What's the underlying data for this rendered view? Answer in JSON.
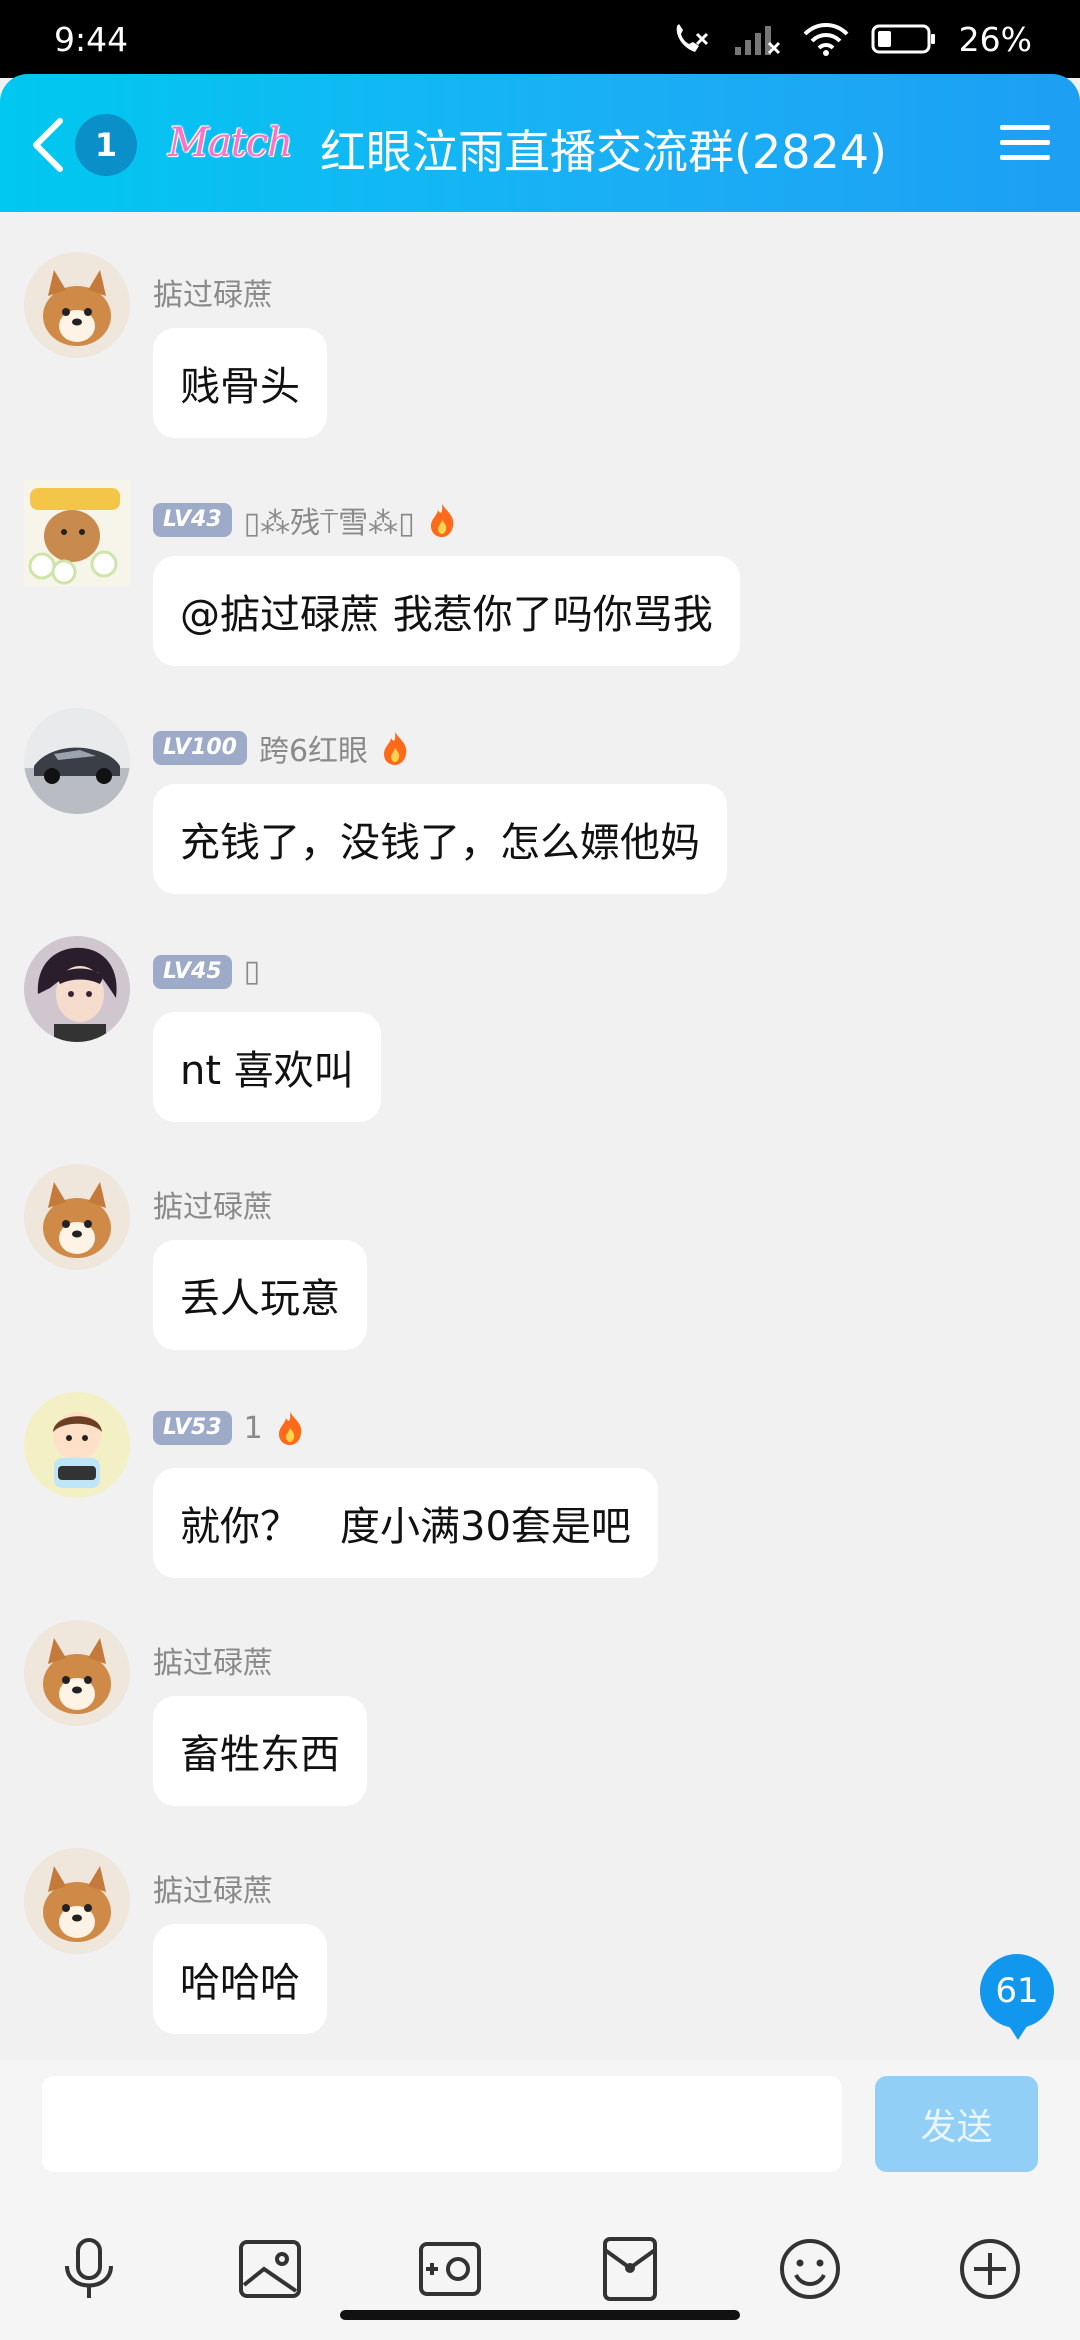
{
  "status_bar": {
    "time": "9:44",
    "battery": "26%"
  },
  "header": {
    "unread_count": "1",
    "logo_text": "Match",
    "title": "红眼泣雨直播交流群(2824)"
  },
  "messages": [
    {
      "sender": "掂过碌蔗",
      "level": "",
      "fire": false,
      "text": "贱骨头",
      "avatar": "shiba-dog-avatar"
    },
    {
      "sender": "▯⁂残⍑雪⁂▯",
      "level": "LV43",
      "fire": true,
      "text": "@掂过碌蔗 我惹你了吗你骂我",
      "avatar": "cartoon-flower-avatar"
    },
    {
      "sender": "跨6红眼",
      "level": "LV100",
      "fire": true,
      "text": "充钱了，没钱了，怎么嫖他妈",
      "avatar": "car-avatar"
    },
    {
      "sender": "▯",
      "level": "LV45",
      "fire": false,
      "text": "nt 喜欢叫",
      "avatar": "anime-boy-avatar"
    },
    {
      "sender": "掂过碌蔗",
      "level": "",
      "fire": false,
      "text": "丢人玩意",
      "avatar": "shiba-dog-avatar"
    },
    {
      "sender": "1",
      "level": "LV53",
      "fire": true,
      "text": "就你？　度小满30套是吧",
      "avatar": "cartoon-kid-avatar"
    },
    {
      "sender": "掂过碌蔗",
      "level": "",
      "fire": false,
      "text": "畜牲东西",
      "avatar": "shiba-dog-avatar"
    },
    {
      "sender": "掂过碌蔗",
      "level": "",
      "fire": false,
      "text": "哈哈哈",
      "avatar": "shiba-dog-avatar"
    }
  ],
  "new_message_count": "61",
  "input": {
    "placeholder": "",
    "send_label": "发送"
  },
  "toolbar": [
    "microphone-icon",
    "image-icon",
    "camera-icon",
    "red-packet-icon",
    "emoji-icon",
    "plus-icon"
  ],
  "colors": {
    "header_start": "#00c8f0",
    "header_end": "#1d9ff4",
    "accent": "#1297ee",
    "level_badge": "#9eabc8"
  }
}
